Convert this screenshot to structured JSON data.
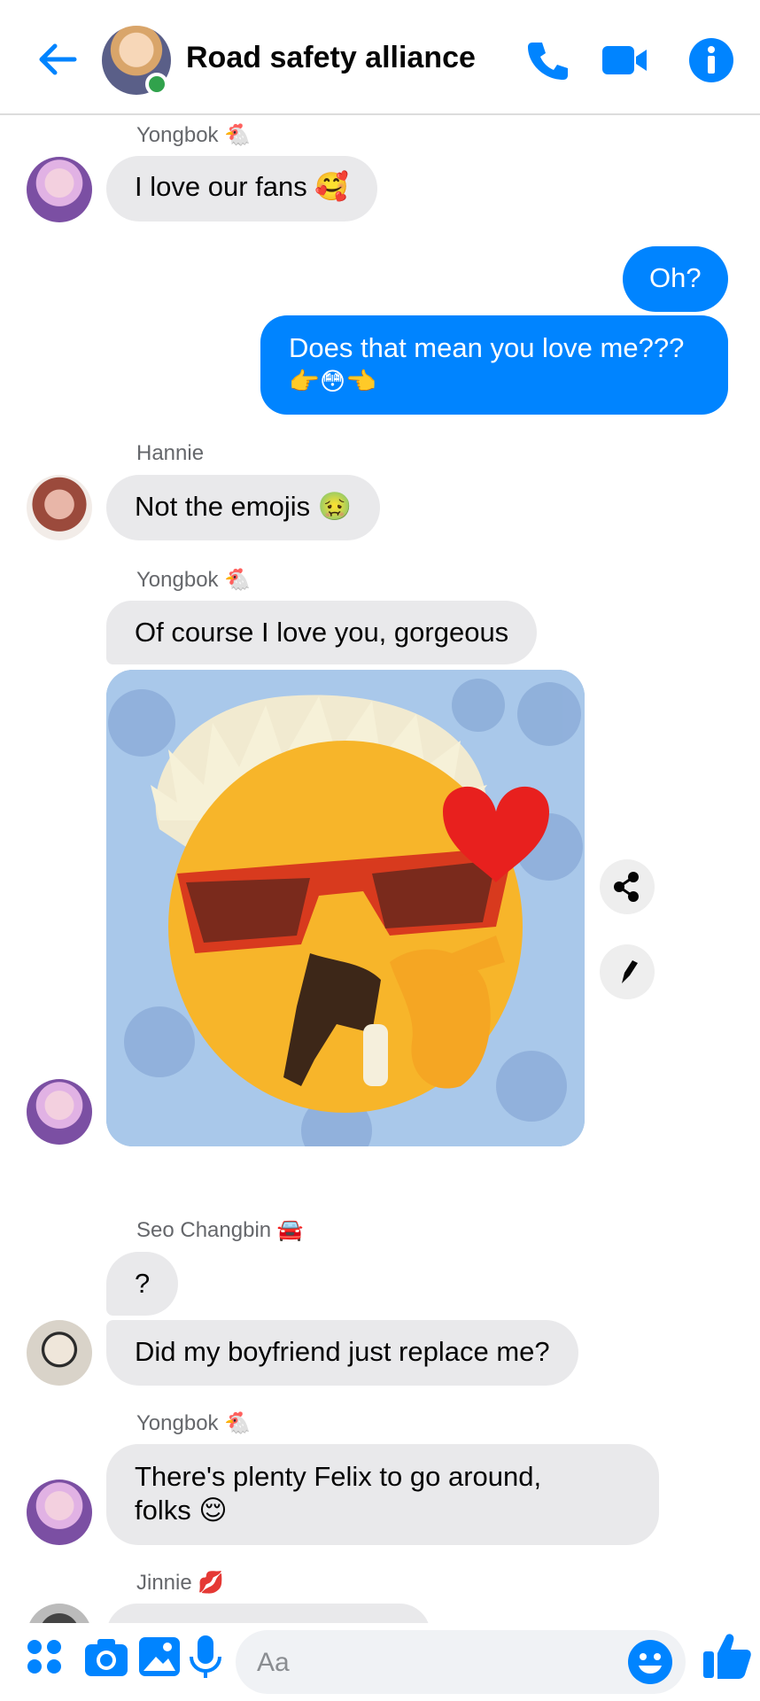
{
  "header": {
    "title": "Road safety alliance",
    "back_icon": "back-arrow-icon",
    "actions": [
      "phone-icon",
      "video-icon",
      "info-icon"
    ]
  },
  "messages": [
    {
      "sender": "Yongbok 🐔",
      "text": "I love our fans 🥰",
      "avatar": "yongbok"
    },
    {
      "me": true,
      "text": "Oh?"
    },
    {
      "me": true,
      "text_line1": "Does that mean you love me???",
      "text_line2": "👉😳👈"
    },
    {
      "sender": "Hannie",
      "text": "Not the emojis 🤢",
      "avatar": "hannie"
    },
    {
      "sender": "Yongbok 🐔",
      "text": "Of course I love you, gorgeous",
      "image": "sunglasses-chef-kiss-emoji"
    },
    {
      "sender": "Seo Changbin 🚘",
      "text1": "?",
      "text2": "Did my boyfriend just replace me?"
    },
    {
      "sender": "Yongbok 🐔",
      "text_line1": "There's plenty Felix to go around,",
      "text_line2": "folks 😌"
    },
    {
      "sender": "Jinnie 💋"
    }
  ],
  "composer": {
    "placeholder": "Aa",
    "icons": [
      "apps-icon",
      "camera-icon",
      "gallery-icon",
      "microphone-icon",
      "emoji-icon",
      "like-icon"
    ]
  },
  "colors": {
    "accent": "#0084ff",
    "bubble_other": "#e9e9eb",
    "online": "#31a24c"
  }
}
